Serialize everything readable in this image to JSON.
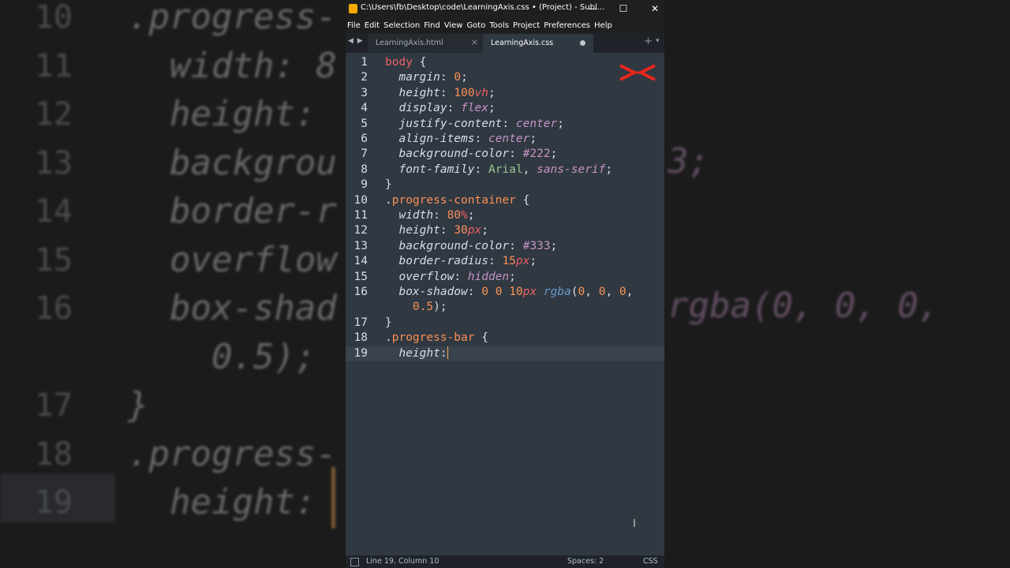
{
  "window": {
    "title": "C:\\Users\\fb\\Desktop\\code\\LearningAxis.css • (Project) - Subl...",
    "minimize": "—",
    "maximize": "☐",
    "close": "✕"
  },
  "menu": [
    "File",
    "Edit",
    "Selection",
    "Find",
    "View",
    "Goto",
    "Tools",
    "Project",
    "Preferences",
    "Help"
  ],
  "tabs": {
    "nav": "◀ ▶",
    "items": [
      {
        "label": "LearningAxis.html",
        "close": "×"
      },
      {
        "label": "LearningAxis.css"
      }
    ],
    "new_tab": "+",
    "menu": "▾"
  },
  "editor": {
    "lines": [
      {
        "num": "1",
        "tokens": [
          [
            "sel",
            "body"
          ],
          [
            "punct",
            " {"
          ]
        ]
      },
      {
        "num": "2",
        "tokens": [
          [
            "punct",
            "  "
          ],
          [
            "prop",
            "margin"
          ],
          [
            "punct",
            ": "
          ],
          [
            "num",
            "0"
          ],
          [
            "punct",
            ";"
          ]
        ]
      },
      {
        "num": "3",
        "tokens": [
          [
            "punct",
            "  "
          ],
          [
            "prop",
            "height"
          ],
          [
            "punct",
            ": "
          ],
          [
            "num",
            "100"
          ],
          [
            "unit",
            "vh"
          ],
          [
            "punct",
            ";"
          ]
        ]
      },
      {
        "num": "4",
        "tokens": [
          [
            "punct",
            "  "
          ],
          [
            "prop",
            "display"
          ],
          [
            "punct",
            ": "
          ],
          [
            "kw",
            "flex"
          ],
          [
            "punct",
            ";"
          ]
        ]
      },
      {
        "num": "5",
        "tokens": [
          [
            "punct",
            "  "
          ],
          [
            "prop",
            "justify-content"
          ],
          [
            "punct",
            ": "
          ],
          [
            "kw",
            "center"
          ],
          [
            "punct",
            ";"
          ]
        ]
      },
      {
        "num": "6",
        "tokens": [
          [
            "punct",
            "  "
          ],
          [
            "prop",
            "align-items"
          ],
          [
            "punct",
            ": "
          ],
          [
            "kw",
            "center"
          ],
          [
            "punct",
            ";"
          ]
        ]
      },
      {
        "num": "7",
        "tokens": [
          [
            "punct",
            "  "
          ],
          [
            "prop",
            "background-color"
          ],
          [
            "punct",
            ": "
          ],
          [
            "hex",
            "#222"
          ],
          [
            "punct",
            ";"
          ]
        ]
      },
      {
        "num": "8",
        "tokens": [
          [
            "punct",
            "  "
          ],
          [
            "prop",
            "font-family"
          ],
          [
            "punct",
            ": "
          ],
          [
            "str",
            "Arial"
          ],
          [
            "punct",
            ", "
          ],
          [
            "kw",
            "sans-serif"
          ],
          [
            "punct",
            ";"
          ]
        ]
      },
      {
        "num": "9",
        "tokens": [
          [
            "punct",
            "}"
          ]
        ]
      },
      {
        "num": "10",
        "tokens": [
          [
            "punct",
            "."
          ],
          [
            "class",
            "progress-container"
          ],
          [
            "punct",
            " {"
          ]
        ]
      },
      {
        "num": "11",
        "tokens": [
          [
            "punct",
            "  "
          ],
          [
            "prop",
            "width"
          ],
          [
            "punct",
            ": "
          ],
          [
            "num",
            "80"
          ],
          [
            "unit",
            "%"
          ],
          [
            "punct",
            ";"
          ]
        ]
      },
      {
        "num": "12",
        "tokens": [
          [
            "punct",
            "  "
          ],
          [
            "prop",
            "height"
          ],
          [
            "punct",
            ": "
          ],
          [
            "num",
            "30"
          ],
          [
            "unit",
            "px"
          ],
          [
            "punct",
            ";"
          ]
        ]
      },
      {
        "num": "13",
        "tokens": [
          [
            "punct",
            "  "
          ],
          [
            "prop",
            "background-color"
          ],
          [
            "punct",
            ": "
          ],
          [
            "hex",
            "#333"
          ],
          [
            "punct",
            ";"
          ]
        ]
      },
      {
        "num": "14",
        "tokens": [
          [
            "punct",
            "  "
          ],
          [
            "prop",
            "border-radius"
          ],
          [
            "punct",
            ": "
          ],
          [
            "num",
            "15"
          ],
          [
            "unit",
            "px"
          ],
          [
            "punct",
            ";"
          ]
        ]
      },
      {
        "num": "15",
        "tokens": [
          [
            "punct",
            "  "
          ],
          [
            "prop",
            "overflow"
          ],
          [
            "punct",
            ": "
          ],
          [
            "kw",
            "hidden"
          ],
          [
            "punct",
            ";"
          ]
        ]
      },
      {
        "num": "16",
        "tokens": [
          [
            "punct",
            "  "
          ],
          [
            "prop",
            "box-shadow"
          ],
          [
            "punct",
            ": "
          ],
          [
            "num",
            "0"
          ],
          [
            "punct",
            " "
          ],
          [
            "num",
            "0"
          ],
          [
            "punct",
            " "
          ],
          [
            "num",
            "10"
          ],
          [
            "unit",
            "px"
          ],
          [
            "punct",
            " "
          ],
          [
            "fn",
            "rgba"
          ],
          [
            "punct",
            "("
          ],
          [
            "num",
            "0"
          ],
          [
            "punct",
            ", "
          ],
          [
            "num",
            "0"
          ],
          [
            "punct",
            ", "
          ],
          [
            "num",
            "0"
          ],
          [
            "punct",
            ","
          ]
        ]
      },
      {
        "num": "",
        "tokens": [
          [
            "punct",
            "    "
          ],
          [
            "num",
            "0.5"
          ],
          [
            "punct",
            ");"
          ]
        ]
      },
      {
        "num": "17",
        "tokens": [
          [
            "punct",
            "}"
          ]
        ]
      },
      {
        "num": "18",
        "tokens": [
          [
            "punct",
            "."
          ],
          [
            "class",
            "progress-bar"
          ],
          [
            "punct",
            " {"
          ]
        ]
      },
      {
        "num": "19",
        "tokens": [
          [
            "punct",
            "  "
          ],
          [
            "prop",
            "height"
          ],
          [
            "punct",
            ":"
          ]
        ],
        "current": true
      }
    ]
  },
  "background_zoom": {
    "rows": [
      {
        "num": "10",
        "code": ".progress-"
      },
      {
        "num": "11",
        "code": "  width: 8"
      },
      {
        "num": "12",
        "code": "  height:"
      },
      {
        "num": "13",
        "code": "  backgrou"
      },
      {
        "num": "14",
        "code": "  border-r"
      },
      {
        "num": "15",
        "code": "  overflow"
      },
      {
        "num": "16",
        "code": "  box-shad"
      },
      {
        "num": "",
        "code": "    0.5);"
      },
      {
        "num": "17",
        "code": "}"
      },
      {
        "num": "18",
        "code": ".progress-"
      },
      {
        "num": "19",
        "code": "  height:"
      }
    ],
    "right_13": "3;",
    "right_16": "rgba(0, 0, 0,"
  },
  "status": {
    "position": "Line 19, Column 10",
    "spaces": "Spaces: 2",
    "syntax": "CSS"
  },
  "colors": {
    "editor_bg": "#303841",
    "selector": "#ec5f67",
    "number": "#f99157",
    "keyword": "#c594c5",
    "string": "#99c794",
    "function": "#6699cc",
    "caret": "#f9ae58",
    "logo": "#e8261c"
  }
}
